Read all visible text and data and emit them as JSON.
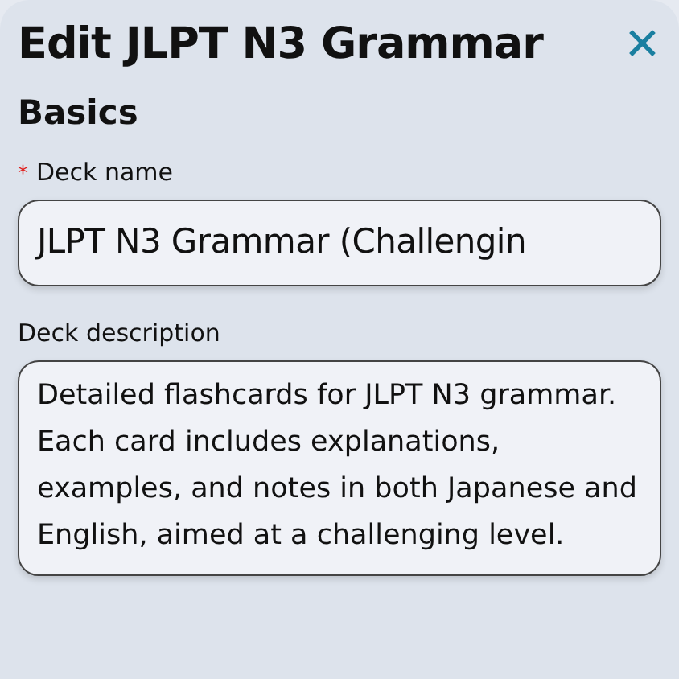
{
  "dialog": {
    "title": "Edit JLPT N3 Grammar",
    "close": "✕"
  },
  "section": {
    "title": "Basics"
  },
  "fields": [
    {
      "kind": "text",
      "label": "Deck name",
      "required_mark": "*",
      "value": "JLPT N3 Grammar (Challengin"
    },
    {
      "kind": "textarea",
      "label": "Deck description",
      "value": "Detailed flashcards for JLPT N3 grammar. Each card includes explanations, examples, and notes in both Japanese and English, aimed at a challenging level."
    }
  ]
}
